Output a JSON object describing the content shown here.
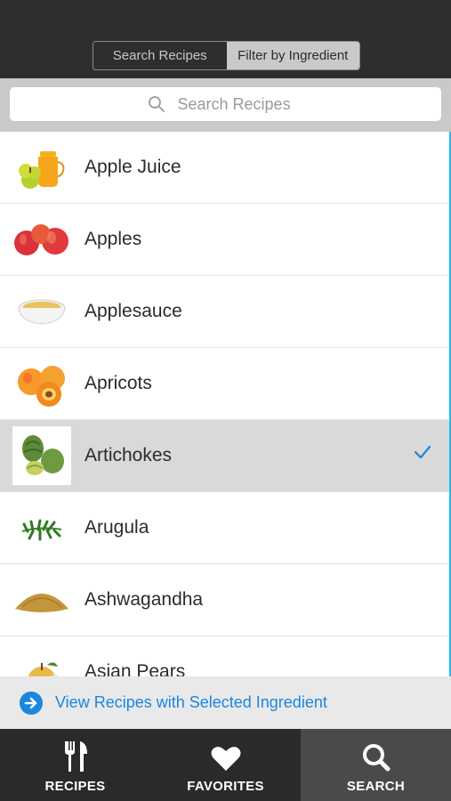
{
  "segments": {
    "search_recipes": "Search Recipes",
    "filter_by_ingredient": "Filter by Ingredient",
    "active": "filter_by_ingredient"
  },
  "search": {
    "placeholder": "Search Recipes"
  },
  "ingredients": [
    {
      "name": "Apple Juice",
      "icon": "apple-juice-icon"
    },
    {
      "name": "Apples",
      "icon": "apples-icon"
    },
    {
      "name": "Applesauce",
      "icon": "applesauce-icon"
    },
    {
      "name": "Apricots",
      "icon": "apricots-icon"
    },
    {
      "name": "Artichokes",
      "icon": "artichokes-icon",
      "selected": true
    },
    {
      "name": "Arugula",
      "icon": "arugula-icon"
    },
    {
      "name": "Ashwagandha",
      "icon": "ashwagandha-icon"
    },
    {
      "name": "Asian Pears",
      "icon": "asian-pears-icon"
    }
  ],
  "view_selected": {
    "label": "View Recipes with Selected Ingredient"
  },
  "tabs": [
    {
      "label": "RECIPES",
      "icon": "fork-knife-icon"
    },
    {
      "label": "FAVORITES",
      "icon": "heart-icon"
    },
    {
      "label": "SEARCH",
      "icon": "search-icon",
      "active": true
    }
  ],
  "colors": {
    "accent": "#1a86e0",
    "topbar": "#2e2e2e",
    "selected_row": "#d9d9d9",
    "tabbar": "#2a2a2a"
  }
}
